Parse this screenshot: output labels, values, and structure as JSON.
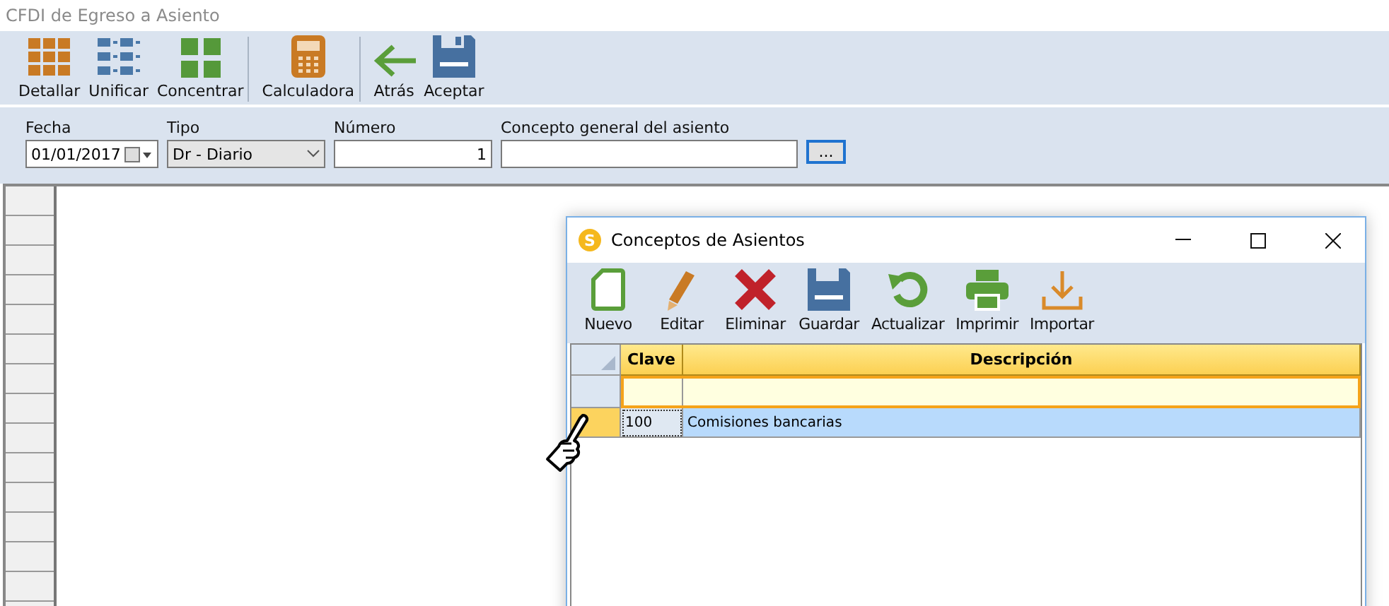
{
  "window": {
    "title": "CFDI de Egreso a Asiento"
  },
  "toolbar": [
    {
      "label": "Detallar"
    },
    {
      "label": "Unificar"
    },
    {
      "label": "Concentrar"
    },
    {
      "label": "Calculadora",
      "separator": true
    },
    {
      "label": "Atrás",
      "separator": true
    },
    {
      "label": "Aceptar"
    }
  ],
  "form": {
    "fecha": {
      "label": "Fecha",
      "value": "01/01/2017"
    },
    "tipo": {
      "label": "Tipo",
      "value": "Dr - Diario"
    },
    "numero": {
      "label": "Número",
      "value": "1"
    },
    "concepto": {
      "label": "Concepto general del asiento"
    },
    "browse_button": "..."
  },
  "dialog": {
    "title": "Conceptos de Asientos",
    "logo": "S",
    "toolbar": [
      {
        "label": "Nuevo"
      },
      {
        "label": "Editar"
      },
      {
        "label": "Eliminar"
      },
      {
        "label": "Guardar"
      },
      {
        "label": "Actualizar"
      },
      {
        "label": "Imprimir"
      },
      {
        "label": "Importar"
      }
    ],
    "columns": [
      "Clave",
      "Descripción"
    ],
    "rows": [
      {
        "clave": "100",
        "descripcion": "Comisiones bancarias",
        "selected": true
      }
    ]
  }
}
